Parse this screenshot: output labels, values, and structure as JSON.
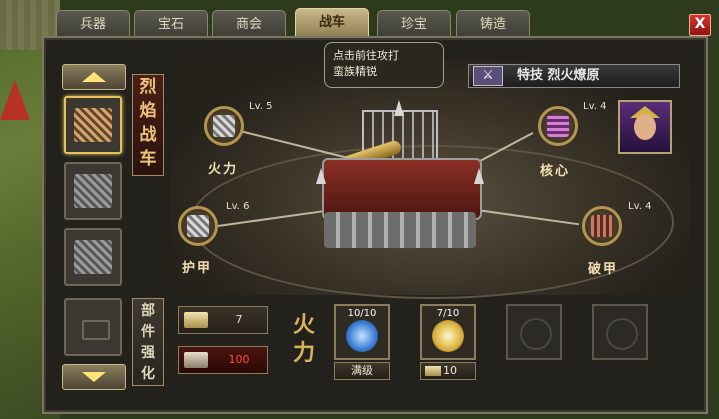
{
  "tabs": [
    {
      "label": "兵器",
      "active": false
    },
    {
      "label": "宝石",
      "active": false
    },
    {
      "label": "商会",
      "active": false
    },
    {
      "label": "战车",
      "active": true
    },
    {
      "label": "珍宝",
      "active": false
    },
    {
      "label": "铸造",
      "active": false
    }
  ],
  "close_label": "X",
  "tooltip": {
    "line1": "点击前往攻打",
    "line2": "蛮族精锐"
  },
  "skill": {
    "label": "特技 烈火燎原",
    "icon": "crossed-swords-icon"
  },
  "chariot_title": [
    "烈",
    "焰",
    "战",
    "车"
  ],
  "parts_title": [
    "部",
    "件",
    "强",
    "化"
  ],
  "parts": [
    {
      "name": "火力",
      "level": "Lv. 5",
      "icon": "firepower-part-icon"
    },
    {
      "name": "护甲",
      "level": "Lv. 6",
      "icon": "armor-part-icon"
    },
    {
      "name": "核心",
      "level": "Lv. 4",
      "icon": "core-part-icon"
    },
    {
      "name": "破甲",
      "level": "Lv. 4",
      "icon": "pierce-part-icon"
    }
  ],
  "resources": {
    "material": "7",
    "cost": "100"
  },
  "focus_part": [
    "火",
    "力"
  ],
  "upgrade_slots": [
    {
      "count": "10/10",
      "button": "满级",
      "color": "#3b7bd4"
    },
    {
      "count": "7/10",
      "button": "10",
      "color": "#d8b23a"
    }
  ],
  "colors": {
    "accent": "#e6c35a",
    "danger": "#ff4a3a",
    "panel": "#23211c"
  }
}
